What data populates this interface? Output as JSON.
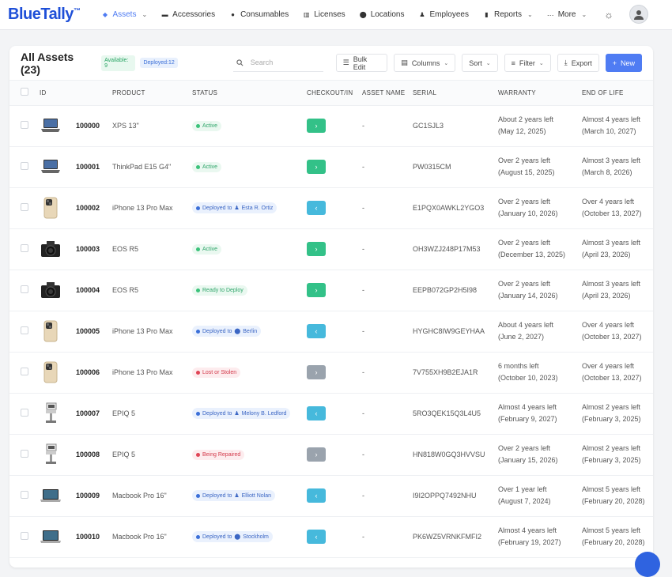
{
  "nav": {
    "logo": "BlueTally",
    "logo_tm": "™",
    "items": [
      {
        "label": "Assets",
        "icon": "tag-icon",
        "active": true,
        "dropdown": true
      },
      {
        "label": "Accessories",
        "icon": "keyboard-icon"
      },
      {
        "label": "Consumables",
        "icon": "drop-icon"
      },
      {
        "label": "Licenses",
        "icon": "barcode-icon"
      },
      {
        "label": "Locations",
        "icon": "pin-icon"
      },
      {
        "label": "Employees",
        "icon": "people-icon"
      },
      {
        "label": "Reports",
        "icon": "chart-icon",
        "dropdown": true
      },
      {
        "label": "More",
        "icon": "dots-icon",
        "dropdown": true
      }
    ]
  },
  "header": {
    "title": "All Assets (23)",
    "available_badge": "Available: 9",
    "deployed_badge": "Deployed:12",
    "search_placeholder": "Search",
    "bulk_edit": "Bulk Edit",
    "columns": "Columns",
    "sort": "Sort",
    "filter": "Filter",
    "export": "Export",
    "new": "New"
  },
  "columns": [
    "ID",
    "PRODUCT",
    "STATUS",
    "CHECKOUT/IN",
    "ASSET NAME",
    "SERIAL",
    "WARRANTY",
    "END OF LIFE"
  ],
  "rows": [
    {
      "icon": "laptop-icon",
      "id": "100000",
      "product": "XPS 13\"",
      "status": "Active",
      "status_type": "green",
      "deploy_kind": "",
      "deploy_target": "",
      "checkout": "out",
      "asset_name": "-",
      "serial": "GC1SJL3",
      "warranty_1": "About 2 years left",
      "warranty_2": "(May 12, 2025)",
      "eol_1": "Almost 4 years left",
      "eol_2": "(March 10, 2027)"
    },
    {
      "icon": "laptop-icon",
      "id": "100001",
      "product": "ThinkPad E15 G4\"",
      "status": "Active",
      "status_type": "green",
      "deploy_kind": "",
      "deploy_target": "",
      "checkout": "out",
      "asset_name": "-",
      "serial": "PW0315CM",
      "warranty_1": "Over 2 years left",
      "warranty_2": "(August 15, 2025)",
      "eol_1": "Almost 3 years left",
      "eol_2": "(March 8, 2026)"
    },
    {
      "icon": "phone-icon",
      "id": "100002",
      "product": "iPhone 13 Pro Max",
      "status": "Deployed to",
      "status_type": "blue",
      "deploy_kind": "person",
      "deploy_target": "Esta R. Ortiz",
      "checkout": "in",
      "asset_name": "-",
      "serial": "E1PQX0AWKL2YGO3",
      "warranty_1": "Over 2 years left",
      "warranty_2": "(January 10, 2026)",
      "eol_1": "Over 4 years left",
      "eol_2": "(October 13, 2027)"
    },
    {
      "icon": "camera-icon",
      "id": "100003",
      "product": "EOS R5",
      "status": "Active",
      "status_type": "green",
      "deploy_kind": "",
      "deploy_target": "",
      "checkout": "out",
      "asset_name": "-",
      "serial": "OH3WZJ248P17M53",
      "warranty_1": "Over 2 years left",
      "warranty_2": "(December 13, 2025)",
      "eol_1": "Almost 3 years left",
      "eol_2": "(April 23, 2026)"
    },
    {
      "icon": "camera-icon",
      "id": "100004",
      "product": "EOS R5",
      "status": "Ready to Deploy",
      "status_type": "green",
      "deploy_kind": "",
      "deploy_target": "",
      "checkout": "out",
      "asset_name": "-",
      "serial": "EEPB072GP2H5I98",
      "warranty_1": "Over 2 years left",
      "warranty_2": "(January 14, 2026)",
      "eol_1": "Almost 3 years left",
      "eol_2": "(April 23, 2026)"
    },
    {
      "icon": "phone-icon",
      "id": "100005",
      "product": "iPhone 13 Pro Max",
      "status": "Deployed to",
      "status_type": "blue",
      "deploy_kind": "location",
      "deploy_target": "Berlin",
      "checkout": "in",
      "asset_name": "-",
      "serial": "HYGHC8IW9GEYHAA",
      "warranty_1": "About 4 years left",
      "warranty_2": "(June 2, 2027)",
      "eol_1": "Over 4 years left",
      "eol_2": "(October 13, 2027)"
    },
    {
      "icon": "phone-icon",
      "id": "100006",
      "product": "iPhone 13 Pro Max",
      "status": "Lost or Stolen",
      "status_type": "red",
      "deploy_kind": "",
      "deploy_target": "",
      "checkout": "disabled",
      "asset_name": "-",
      "serial": "7V755XH9B2EJA1R",
      "warranty_1": "6 months left",
      "warranty_2": "(October 10, 2023)",
      "eol_1": "Over 4 years left",
      "eol_2": "(October 13, 2027)"
    },
    {
      "icon": "ultrasound-icon",
      "id": "100007",
      "product": "EPIQ 5",
      "status": "Deployed to",
      "status_type": "blue",
      "deploy_kind": "person",
      "deploy_target": "Melony B. Ledford",
      "checkout": "in",
      "asset_name": "-",
      "serial": "5RO3QEK15Q3L4U5",
      "warranty_1": "Almost 4 years left",
      "warranty_2": "(February 9, 2027)",
      "eol_1": "Almost 2 years left",
      "eol_2": "(February 3, 2025)"
    },
    {
      "icon": "ultrasound-icon",
      "id": "100008",
      "product": "EPIQ 5",
      "status": "Being Repaired",
      "status_type": "red",
      "deploy_kind": "",
      "deploy_target": "",
      "checkout": "disabled",
      "asset_name": "-",
      "serial": "HN818W0GQ3HVVSU",
      "warranty_1": "Over 2 years left",
      "warranty_2": "(January 15, 2026)",
      "eol_1": "Almost 2 years left",
      "eol_2": "(February 3, 2025)"
    },
    {
      "icon": "macbook-icon",
      "id": "100009",
      "product": "Macbook Pro 16\"",
      "status": "Deployed to",
      "status_type": "blue",
      "deploy_kind": "person",
      "deploy_target": "Elliott Nolan",
      "checkout": "in",
      "asset_name": "-",
      "serial": "I9I2OPPQ7492NHU",
      "warranty_1": "Over 1 year left",
      "warranty_2": "(August 7, 2024)",
      "eol_1": "Almost 5 years left",
      "eol_2": "(February 20, 2028)"
    },
    {
      "icon": "macbook-icon",
      "id": "100010",
      "product": "Macbook Pro 16\"",
      "status": "Deployed to",
      "status_type": "blue",
      "deploy_kind": "location",
      "deploy_target": "Stockholm",
      "checkout": "in",
      "asset_name": "-",
      "serial": "PK6WZ5VRNKFMFI2",
      "warranty_1": "Almost 4 years left",
      "warranty_2": "(February 19, 2027)",
      "eol_1": "Almost 5 years left",
      "eol_2": "(February 20, 2028)"
    }
  ],
  "colors": {
    "brand": "#1e4fd8",
    "accent": "#4f7cf3",
    "checkout_out": "#33c188",
    "checkout_in": "#46b9dc",
    "checkout_disabled": "#9aa3ad"
  }
}
